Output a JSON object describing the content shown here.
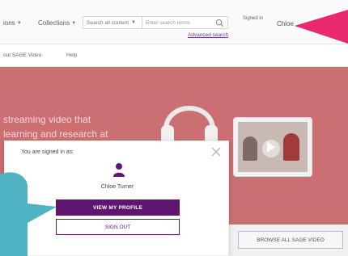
{
  "header": {
    "nav": [
      {
        "label": "ions",
        "icon": "chevron-down-icon"
      },
      {
        "label": "Collections",
        "icon": "chevron-down-icon"
      }
    ],
    "search_select": "Search all content",
    "search_placeholder": "Enter search terms",
    "advanced_search": "Advanced search",
    "signed_in_label": "Signed in",
    "user_link": "Chloe",
    "icons": [
      "search-icon",
      "cart-icon"
    ]
  },
  "subnav": {
    "items": [
      "out SAGE Video",
      "Help"
    ]
  },
  "hero": {
    "lines": [
      "streaming video that",
      "learning and research at"
    ],
    "colors": {
      "background": "#cc6f72",
      "text": "#f3d7d8"
    }
  },
  "browse_button": "BROWSE ALL SAGE VIDEO",
  "popup": {
    "signed_in_as": "You are signed in as:",
    "user_name": "Chloe Turner",
    "view_profile": "VIEW MY PROFILE",
    "sign_out": "SIGN OUT",
    "colors": {
      "primary": "#5e1670"
    }
  },
  "annotations": {
    "colors": {
      "teal": "#4fb3c4",
      "pink": "#e8296d"
    }
  }
}
